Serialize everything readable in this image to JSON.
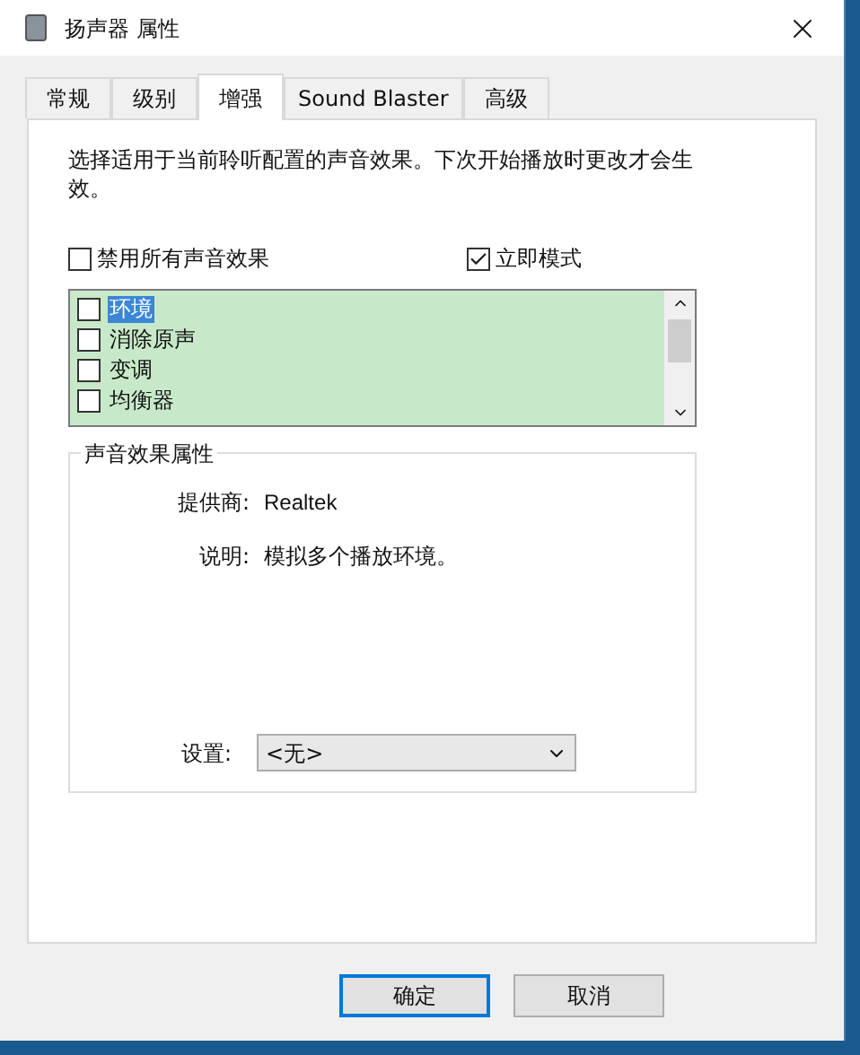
{
  "window": {
    "title": "扬声器 属性"
  },
  "tabs": [
    {
      "label": "常规",
      "selected": false
    },
    {
      "label": "级别",
      "selected": false
    },
    {
      "label": "增强",
      "selected": true
    },
    {
      "label": "Sound Blaster",
      "selected": false
    },
    {
      "label": "高级",
      "selected": false
    }
  ],
  "description": "选择适用于当前聆听配置的声音效果。下次开始播放时更改才会生效。",
  "options": [
    {
      "label": "禁用所有声音效果",
      "checked": false
    },
    {
      "label": "立即模式",
      "checked": true
    }
  ],
  "effects": [
    {
      "label": "环境",
      "checked": false,
      "selected": true
    },
    {
      "label": "消除原声",
      "checked": false,
      "selected": false
    },
    {
      "label": "变调",
      "checked": false,
      "selected": false
    },
    {
      "label": "均衡器",
      "checked": false,
      "selected": false
    }
  ],
  "properties": {
    "title": "声音效果属性",
    "provider_label": "提供商:",
    "provider": "Realtek",
    "description_label": "说明:",
    "description": "模拟多个播放环境。",
    "setting_label": "设置:",
    "setting_value": "<无>"
  },
  "buttons": [
    {
      "label": "确定",
      "default": true
    },
    {
      "label": "取消",
      "default": false
    }
  ]
}
